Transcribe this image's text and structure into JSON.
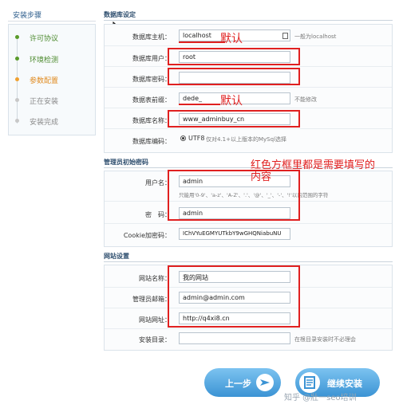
{
  "sidebar": {
    "title": "安装步骤",
    "steps": [
      {
        "label": "许可协议",
        "state": "done"
      },
      {
        "label": "环境检测",
        "state": "done"
      },
      {
        "label": "参数配置",
        "state": "current"
      },
      {
        "label": "正在安装",
        "state": "todo"
      },
      {
        "label": "安装完成",
        "state": "todo"
      }
    ]
  },
  "db": {
    "section_title": "数据库设定",
    "host_label": "数据库主机：",
    "host_value": "localhost",
    "host_hint": "一般为localhost",
    "user_label": "数据库用户：",
    "user_value": "root",
    "pass_label": "数据库密码：",
    "pass_value": "",
    "prefix_label": "数据表前缀：",
    "prefix_value": "dede_",
    "prefix_hint": "不能修改",
    "name_label": "数据库名称：",
    "name_value": "www_adminbuy_cn",
    "charset_label": "数据库编码：",
    "charset_option": "UTF8",
    "charset_hint": "仅对4.1+以上版本的MySql选择"
  },
  "admin": {
    "section_title": "管理员初始密码",
    "user_label": "用户名：",
    "user_value": "admin",
    "user_hint": "只能用'0-9'、'a-z'、'A-Z'、'.'、'@'、'_'、'-'、'!'以内范围的字符",
    "pass_label": "密　码：",
    "pass_value": "admin",
    "cookie_label": "Cookie加密码：",
    "cookie_value": "IChVYuEGMYUTkbY9wGHQNiabuNU"
  },
  "site": {
    "section_title": "网站设置",
    "name_label": "网站名称：",
    "name_value": "我的网站",
    "email_label": "管理员邮箱：",
    "email_value": "admin@admin.com",
    "url_label": "网站网址：",
    "url_value": "http://q4xi8.cn",
    "dir_label": "安装目录：",
    "dir_value": "",
    "dir_hint": "在根目录安装时不必理会"
  },
  "annotations": {
    "default_1": "默认",
    "default_2": "默认",
    "note_line1": "红色方框里都是需要填写的",
    "note_line2": "内容"
  },
  "buttons": {
    "prev_label": "上一步",
    "next_label": "继续安装"
  },
  "watermark": "知乎 @壯一seo培训",
  "colors": {
    "annotation_red": "#e02020",
    "step_done": "#4c8a2e",
    "step_current": "#e08a1e",
    "button_blue": "#3b93d4"
  }
}
